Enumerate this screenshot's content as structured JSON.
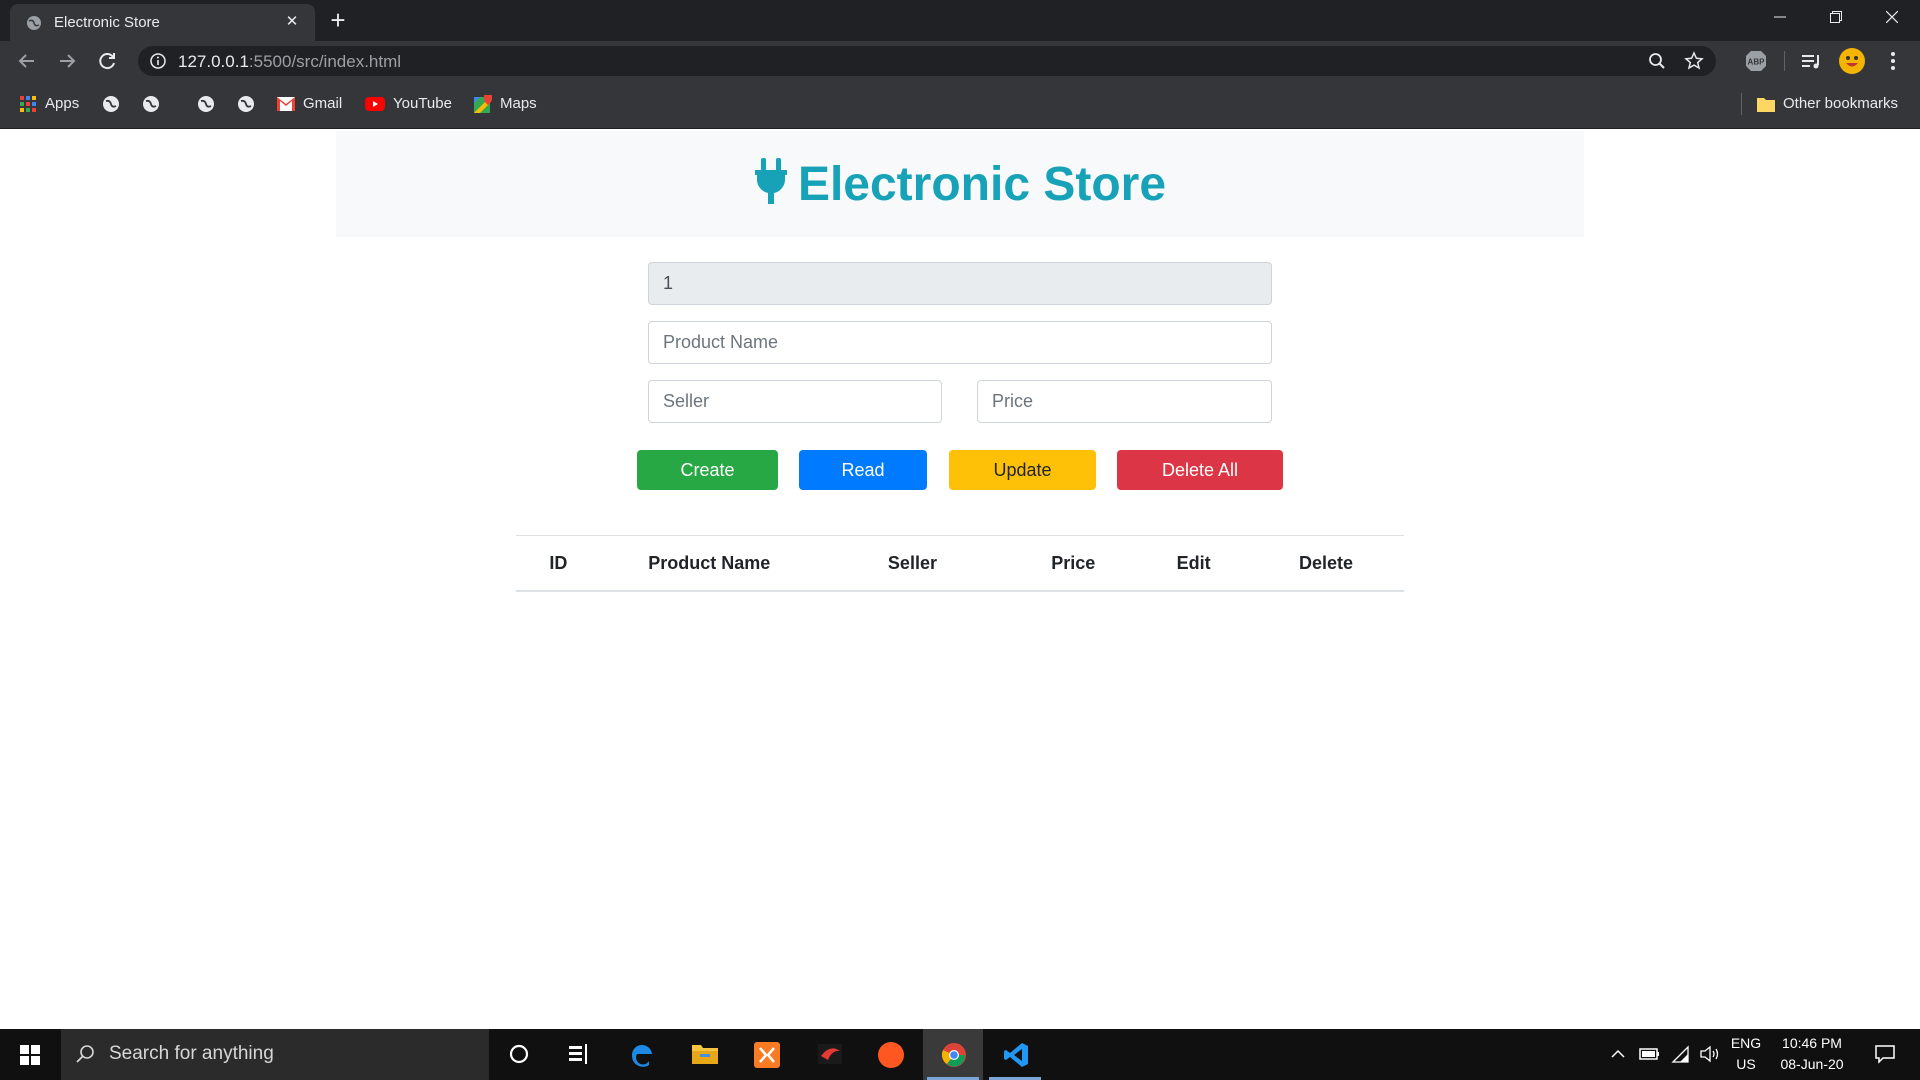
{
  "browser": {
    "tab_title": "Electronic Store",
    "url_host": "127.0.0.1",
    "url_rest": ":5500/src/index.html",
    "bookmarks": {
      "apps": "Apps",
      "gmail": "Gmail",
      "youtube": "YouTube",
      "maps": "Maps",
      "other": "Other bookmarks"
    },
    "extension_abp": "ABP"
  },
  "page": {
    "heading": "Electronic Store",
    "form": {
      "id_value": "1",
      "product_name_placeholder": "Product Name",
      "seller_placeholder": "Seller",
      "price_placeholder": "Price"
    },
    "buttons": {
      "create": "Create",
      "read": "Read",
      "update": "Update",
      "delete_all": "Delete All"
    },
    "table": {
      "headers": [
        "ID",
        "Product Name",
        "Seller",
        "Price",
        "Edit",
        "Delete"
      ],
      "rows": []
    },
    "colors": {
      "brand": "#17a2b8",
      "success": "#28a745",
      "primary": "#007bff",
      "warning": "#ffc107",
      "danger": "#dc3545"
    }
  },
  "taskbar": {
    "search_placeholder": "Search for anything",
    "language": "ENG",
    "region": "US",
    "time": "10:46 PM",
    "date": "08-Jun-20"
  }
}
